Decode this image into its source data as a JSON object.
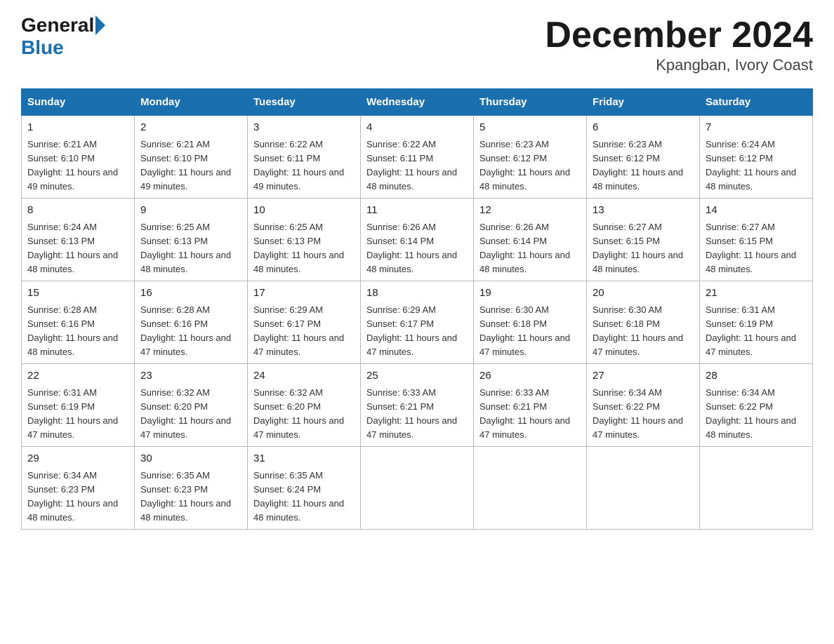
{
  "header": {
    "logo_general": "General",
    "logo_blue": "Blue",
    "month_title": "December 2024",
    "location": "Kpangban, Ivory Coast"
  },
  "days_of_week": [
    "Sunday",
    "Monday",
    "Tuesday",
    "Wednesday",
    "Thursday",
    "Friday",
    "Saturday"
  ],
  "weeks": [
    [
      {
        "day": "1",
        "sunrise": "6:21 AM",
        "sunset": "6:10 PM",
        "daylight": "11 hours and 49 minutes."
      },
      {
        "day": "2",
        "sunrise": "6:21 AM",
        "sunset": "6:10 PM",
        "daylight": "11 hours and 49 minutes."
      },
      {
        "day": "3",
        "sunrise": "6:22 AM",
        "sunset": "6:11 PM",
        "daylight": "11 hours and 49 minutes."
      },
      {
        "day": "4",
        "sunrise": "6:22 AM",
        "sunset": "6:11 PM",
        "daylight": "11 hours and 48 minutes."
      },
      {
        "day": "5",
        "sunrise": "6:23 AM",
        "sunset": "6:12 PM",
        "daylight": "11 hours and 48 minutes."
      },
      {
        "day": "6",
        "sunrise": "6:23 AM",
        "sunset": "6:12 PM",
        "daylight": "11 hours and 48 minutes."
      },
      {
        "day": "7",
        "sunrise": "6:24 AM",
        "sunset": "6:12 PM",
        "daylight": "11 hours and 48 minutes."
      }
    ],
    [
      {
        "day": "8",
        "sunrise": "6:24 AM",
        "sunset": "6:13 PM",
        "daylight": "11 hours and 48 minutes."
      },
      {
        "day": "9",
        "sunrise": "6:25 AM",
        "sunset": "6:13 PM",
        "daylight": "11 hours and 48 minutes."
      },
      {
        "day": "10",
        "sunrise": "6:25 AM",
        "sunset": "6:13 PM",
        "daylight": "11 hours and 48 minutes."
      },
      {
        "day": "11",
        "sunrise": "6:26 AM",
        "sunset": "6:14 PM",
        "daylight": "11 hours and 48 minutes."
      },
      {
        "day": "12",
        "sunrise": "6:26 AM",
        "sunset": "6:14 PM",
        "daylight": "11 hours and 48 minutes."
      },
      {
        "day": "13",
        "sunrise": "6:27 AM",
        "sunset": "6:15 PM",
        "daylight": "11 hours and 48 minutes."
      },
      {
        "day": "14",
        "sunrise": "6:27 AM",
        "sunset": "6:15 PM",
        "daylight": "11 hours and 48 minutes."
      }
    ],
    [
      {
        "day": "15",
        "sunrise": "6:28 AM",
        "sunset": "6:16 PM",
        "daylight": "11 hours and 48 minutes."
      },
      {
        "day": "16",
        "sunrise": "6:28 AM",
        "sunset": "6:16 PM",
        "daylight": "11 hours and 47 minutes."
      },
      {
        "day": "17",
        "sunrise": "6:29 AM",
        "sunset": "6:17 PM",
        "daylight": "11 hours and 47 minutes."
      },
      {
        "day": "18",
        "sunrise": "6:29 AM",
        "sunset": "6:17 PM",
        "daylight": "11 hours and 47 minutes."
      },
      {
        "day": "19",
        "sunrise": "6:30 AM",
        "sunset": "6:18 PM",
        "daylight": "11 hours and 47 minutes."
      },
      {
        "day": "20",
        "sunrise": "6:30 AM",
        "sunset": "6:18 PM",
        "daylight": "11 hours and 47 minutes."
      },
      {
        "day": "21",
        "sunrise": "6:31 AM",
        "sunset": "6:19 PM",
        "daylight": "11 hours and 47 minutes."
      }
    ],
    [
      {
        "day": "22",
        "sunrise": "6:31 AM",
        "sunset": "6:19 PM",
        "daylight": "11 hours and 47 minutes."
      },
      {
        "day": "23",
        "sunrise": "6:32 AM",
        "sunset": "6:20 PM",
        "daylight": "11 hours and 47 minutes."
      },
      {
        "day": "24",
        "sunrise": "6:32 AM",
        "sunset": "6:20 PM",
        "daylight": "11 hours and 47 minutes."
      },
      {
        "day": "25",
        "sunrise": "6:33 AM",
        "sunset": "6:21 PM",
        "daylight": "11 hours and 47 minutes."
      },
      {
        "day": "26",
        "sunrise": "6:33 AM",
        "sunset": "6:21 PM",
        "daylight": "11 hours and 47 minutes."
      },
      {
        "day": "27",
        "sunrise": "6:34 AM",
        "sunset": "6:22 PM",
        "daylight": "11 hours and 47 minutes."
      },
      {
        "day": "28",
        "sunrise": "6:34 AM",
        "sunset": "6:22 PM",
        "daylight": "11 hours and 48 minutes."
      }
    ],
    [
      {
        "day": "29",
        "sunrise": "6:34 AM",
        "sunset": "6:23 PM",
        "daylight": "11 hours and 48 minutes."
      },
      {
        "day": "30",
        "sunrise": "6:35 AM",
        "sunset": "6:23 PM",
        "daylight": "11 hours and 48 minutes."
      },
      {
        "day": "31",
        "sunrise": "6:35 AM",
        "sunset": "6:24 PM",
        "daylight": "11 hours and 48 minutes."
      },
      null,
      null,
      null,
      null
    ]
  ],
  "labels": {
    "sunrise": "Sunrise:",
    "sunset": "Sunset:",
    "daylight": "Daylight:"
  }
}
